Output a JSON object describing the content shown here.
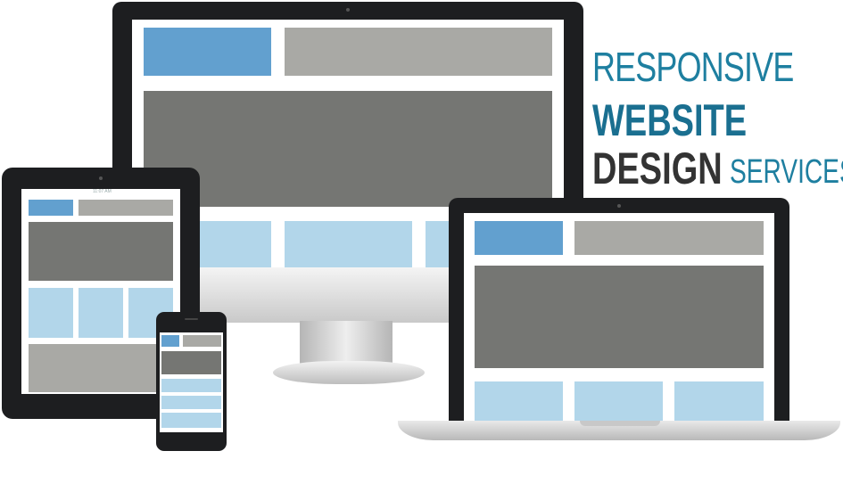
{
  "headline": {
    "line1": "RESPONSIVE",
    "line2": "WEBSITE",
    "line3": "DESIGN",
    "line4": "SERVICES"
  },
  "tablet": {
    "status_time": "11:07 AM"
  },
  "colors": {
    "accent_blue": "#62a0cf",
    "header_gray": "#a9a9a5",
    "content_gray": "#757673",
    "tile_lightblue": "#b2d6ea",
    "frame_black": "#1d1e20",
    "text_teal": "#1e7fa0",
    "text_dark": "#333333"
  }
}
